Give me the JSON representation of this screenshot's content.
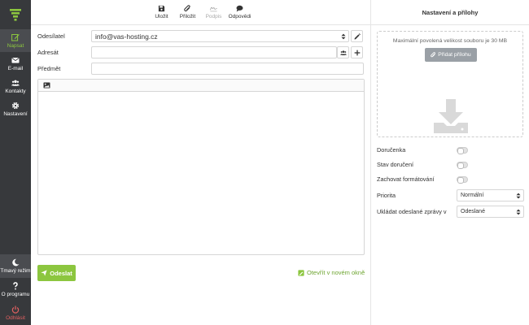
{
  "sidebar": {
    "items": [
      {
        "label": "Napsat",
        "icon": "pencil-square-icon"
      },
      {
        "label": "E-mail",
        "icon": "envelope-icon"
      },
      {
        "label": "Kontakty",
        "icon": "users-icon"
      },
      {
        "label": "Nastavení",
        "icon": "gear-icon"
      }
    ],
    "bottom": [
      {
        "label": "Tmavý režim",
        "icon": "moon-icon"
      },
      {
        "label": "O programu",
        "icon": "question-icon"
      },
      {
        "label": "Odhlásit",
        "icon": "power-icon"
      }
    ]
  },
  "toolbar": {
    "save": "Uložit",
    "attach": "Přiložit",
    "signature": "Podpis",
    "reply": "Odpovědi"
  },
  "form": {
    "from_label": "Odesílatel",
    "from_value": "info@vas-hosting.cz",
    "to_label": "Adresát",
    "to_value": "",
    "subject_label": "Předmět",
    "subject_value": ""
  },
  "actions": {
    "send": "Odeslat",
    "open_new_window": "Otevřít v novém okně"
  },
  "panel": {
    "title": "Nastavení a přílohy",
    "max_size": "Maximální povolená velikost souboru je 30 MB",
    "add_attachment": "Přidat přílohu",
    "receipt": "Doručenka",
    "delivery_status": "Stav doručení",
    "keep_formatting": "Zachovat formátování",
    "priority_label": "Priorita",
    "priority_value": "Normální",
    "save_sent_label": "Ukládat odeslané zprávy v",
    "save_sent_value": "Odeslané"
  },
  "colors": {
    "accent": "#8cc63f",
    "sidebar_bg": "#37393c",
    "logout": "#e06060"
  }
}
